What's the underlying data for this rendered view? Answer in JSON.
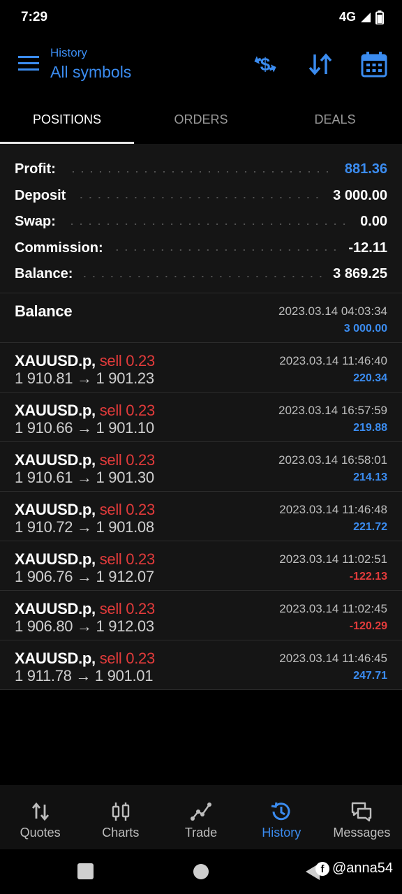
{
  "status_bar": {
    "time": "7:29",
    "network": "4G"
  },
  "header": {
    "subtitle": "History",
    "title": "All symbols"
  },
  "tabs": [
    {
      "label": "POSITIONS",
      "active": true
    },
    {
      "label": "ORDERS",
      "active": false
    },
    {
      "label": "DEALS",
      "active": false
    }
  ],
  "summary": {
    "profit": {
      "label": "Profit:",
      "value": "881.36"
    },
    "deposit": {
      "label": "Deposit",
      "value": "3 000.00"
    },
    "swap": {
      "label": "Swap:",
      "value": "0.00"
    },
    "commission": {
      "label": "Commission:",
      "value": "-12.11"
    },
    "balance": {
      "label": "Balance:",
      "value": "3 869.25"
    }
  },
  "balance_entry": {
    "label": "Balance",
    "date": "2023.03.14 04:03:34",
    "amount": "3 000.00"
  },
  "deals": [
    {
      "symbol": "XAUUSD.p,",
      "type": "sell 0.23",
      "prices": "1 910.81 → 1 901.23",
      "date": "2023.03.14 11:46:40",
      "profit": "220.34",
      "positive": true
    },
    {
      "symbol": "XAUUSD.p,",
      "type": "sell 0.23",
      "prices": "1 910.66 → 1 901.10",
      "date": "2023.03.14 16:57:59",
      "profit": "219.88",
      "positive": true
    },
    {
      "symbol": "XAUUSD.p,",
      "type": "sell 0.23",
      "prices": "1 910.61 → 1 901.30",
      "date": "2023.03.14 16:58:01",
      "profit": "214.13",
      "positive": true
    },
    {
      "symbol": "XAUUSD.p,",
      "type": "sell 0.23",
      "prices": "1 910.72 → 1 901.08",
      "date": "2023.03.14 11:46:48",
      "profit": "221.72",
      "positive": true
    },
    {
      "symbol": "XAUUSD.p,",
      "type": "sell 0.23",
      "prices": "1 906.76 → 1 912.07",
      "date": "2023.03.14 11:02:51",
      "profit": "-122.13",
      "positive": false
    },
    {
      "symbol": "XAUUSD.p,",
      "type": "sell 0.23",
      "prices": "1 906.80 → 1 912.03",
      "date": "2023.03.14 11:02:45",
      "profit": "-120.29",
      "positive": false
    },
    {
      "symbol": "XAUUSD.p,",
      "type": "sell 0.23",
      "prices": "1 911.78 → 1 901.01",
      "date": "2023.03.14 11:46:45",
      "profit": "247.71",
      "positive": true
    }
  ],
  "bottom_nav": [
    {
      "label": "Quotes",
      "icon": "quotes-icon",
      "active": false
    },
    {
      "label": "Charts",
      "icon": "charts-icon",
      "active": false
    },
    {
      "label": "Trade",
      "icon": "trade-icon",
      "active": false
    },
    {
      "label": "History",
      "icon": "history-icon",
      "active": true
    },
    {
      "label": "Messages",
      "icon": "messages-icon",
      "active": false
    }
  ],
  "watermark": {
    "handle": "@anna54"
  },
  "colors": {
    "accent": "#3b8cf0",
    "loss": "#e23b3b",
    "background": "#000000",
    "panel": "#151515"
  }
}
